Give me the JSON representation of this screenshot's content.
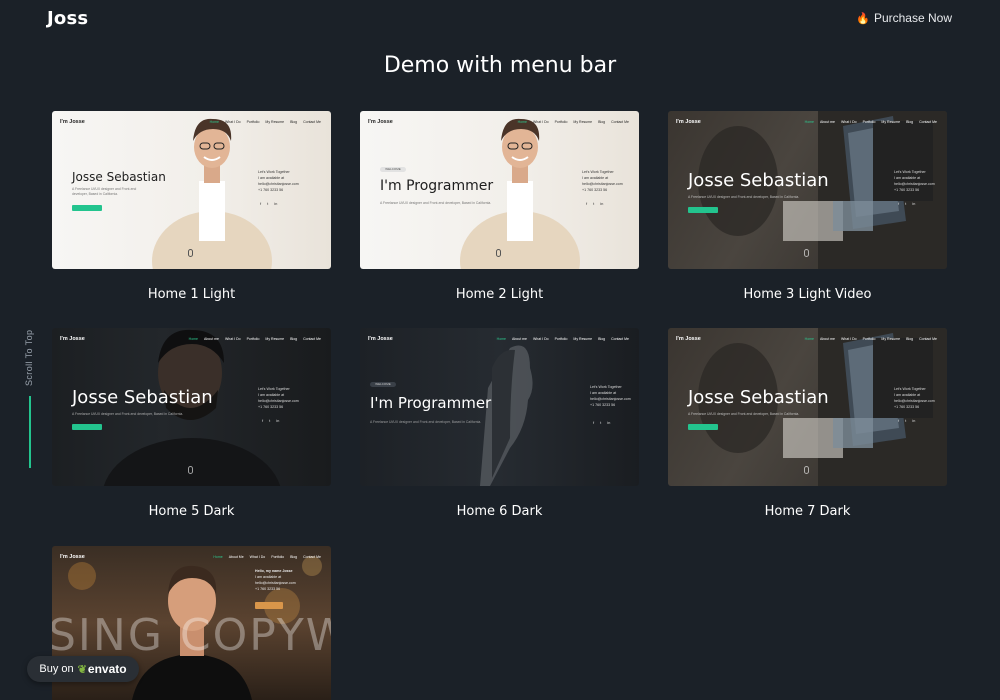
{
  "header": {
    "logo": "Joss",
    "purchase_label": "Purchase Now",
    "purchase_icon": "fire-icon"
  },
  "section_title": "Demo with menu bar",
  "scroll_to_top": "Scroll To Top",
  "demos": [
    {
      "caption": "Home 1 Light",
      "site": {
        "logo": "I'm Josse",
        "links": [
          "Home",
          "What I Do",
          "Portfolio",
          "My Resume",
          "Blog",
          "Contact Me"
        ],
        "headline": "Josse Sebastian",
        "badge": "",
        "sub": "A Freelance UI/UX designer and Front-end developer, Based in California.",
        "side": [
          "Let's Work Together",
          "I am available at",
          "hello@christianjosse.com",
          "+1 760 3233 56"
        ]
      }
    },
    {
      "caption": "Home 2 Light",
      "site": {
        "logo": "I'm Josse",
        "links": [
          "Home",
          "What I Do",
          "Portfolio",
          "My Resume",
          "Blog",
          "Contact Me"
        ],
        "headline": "I'm Programmer",
        "badge": "WELCOME",
        "sub": "A Freelance UI/UX designer and Front-end developer, Based in California.",
        "side": [
          "Let's Work Together",
          "I am available at",
          "hello@christianjosse.com",
          "+1 760 3233 56"
        ]
      }
    },
    {
      "caption": "Home 3 Light Video",
      "site": {
        "logo": "I'm Josse",
        "links": [
          "Home",
          "About me",
          "What I Do",
          "Portfolio",
          "My Resume",
          "Blog",
          "Contact Me"
        ],
        "headline": "Josse Sebastian",
        "badge": "",
        "sub": "A Freelance UI/UX designer and Front-end developer, Based in California.",
        "side": [
          "Let's Work Together",
          "I am available at",
          "hello@christianjosse.com",
          "+1 760 3233 56"
        ]
      }
    },
    {
      "caption": "Home 5 Dark",
      "site": {
        "logo": "I'm Josse",
        "links": [
          "Home",
          "About me",
          "What I Do",
          "Portfolio",
          "My Resume",
          "Blog",
          "Contact Me"
        ],
        "headline": "Josse Sebastian",
        "badge": "",
        "sub": "A Freelance UI/UX designer and Front-end developer, Based in California.",
        "side": [
          "Let's Work Together",
          "I am available at",
          "hello@christianjosse.com",
          "+1 760 3233 56"
        ]
      }
    },
    {
      "caption": "Home 6 Dark",
      "site": {
        "logo": "I'm Josse",
        "links": [
          "Home",
          "About me",
          "What I Do",
          "Portfolio",
          "My Resume",
          "Blog",
          "Contact Me"
        ],
        "headline": "I'm Programmer",
        "badge": "WELCOME",
        "sub": "A Freelance UI/UX designer and Front-end developer, Based in California.",
        "side": [
          "Let's Work Together",
          "I am available at",
          "hello@christianjosse.com",
          "+1 760 3233 56"
        ]
      }
    },
    {
      "caption": "Home 7 Dark",
      "site": {
        "logo": "I'm Josse",
        "links": [
          "Home",
          "About me",
          "What I Do",
          "Portfolio",
          "My Resume",
          "Blog",
          "Contact Me"
        ],
        "headline": "Josse Sebastian",
        "badge": "",
        "sub": "A Freelance UI/UX designer and Front-end developer, Based in California.",
        "side": [
          "Let's Work Together",
          "I am available at",
          "hello@christianjosse.com",
          "+1 760 3233 56"
        ]
      }
    },
    {
      "caption": "",
      "site": {
        "logo": "I'm Josse",
        "links": [
          "Home",
          "About Me",
          "What I Do",
          "Portfolio",
          "Blog",
          "Contact Me"
        ],
        "headline": "",
        "badge": "",
        "sub": "Hello, my name Josse",
        "side": [
          "Hello, my name Josse",
          "I am available at",
          "hello@christianjosse.com",
          "+1 760 3233 56"
        ],
        "bg_text": "SING COPYW"
      }
    }
  ],
  "envato": {
    "prefix": "Buy on",
    "brand": "envato",
    "icon": "envato-leaf-icon"
  },
  "colors": {
    "background": "#1b2128",
    "accent": "#23c48e",
    "fire": "#ff7a1a"
  }
}
